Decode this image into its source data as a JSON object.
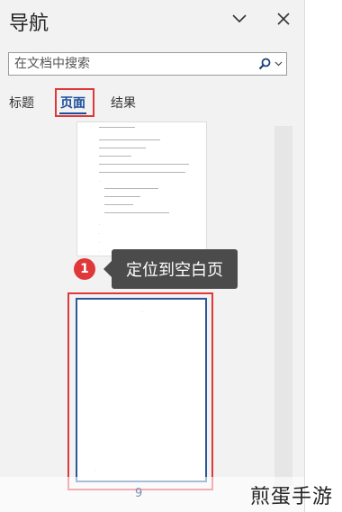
{
  "pane": {
    "title": "导航",
    "collapse_icon": "chevron-down-icon",
    "close_icon": "close-icon"
  },
  "search": {
    "placeholder": "在文档中搜索",
    "icon": "search-icon",
    "dropdown_icon": "chevron-down-icon"
  },
  "tabs": [
    {
      "label": "标题",
      "active": false
    },
    {
      "label": "页面",
      "active": true
    },
    {
      "label": "结果",
      "active": false
    }
  ],
  "callout": {
    "number": "1",
    "text": "定位到空白页"
  },
  "selected_page": {
    "number": "9"
  },
  "watermark": "煎蛋手游",
  "colors": {
    "accent": "#2b579a",
    "highlight": "#e0383a",
    "tooltip_bg": "#4b4b4b",
    "pane_bg": "#f2f2f2"
  }
}
